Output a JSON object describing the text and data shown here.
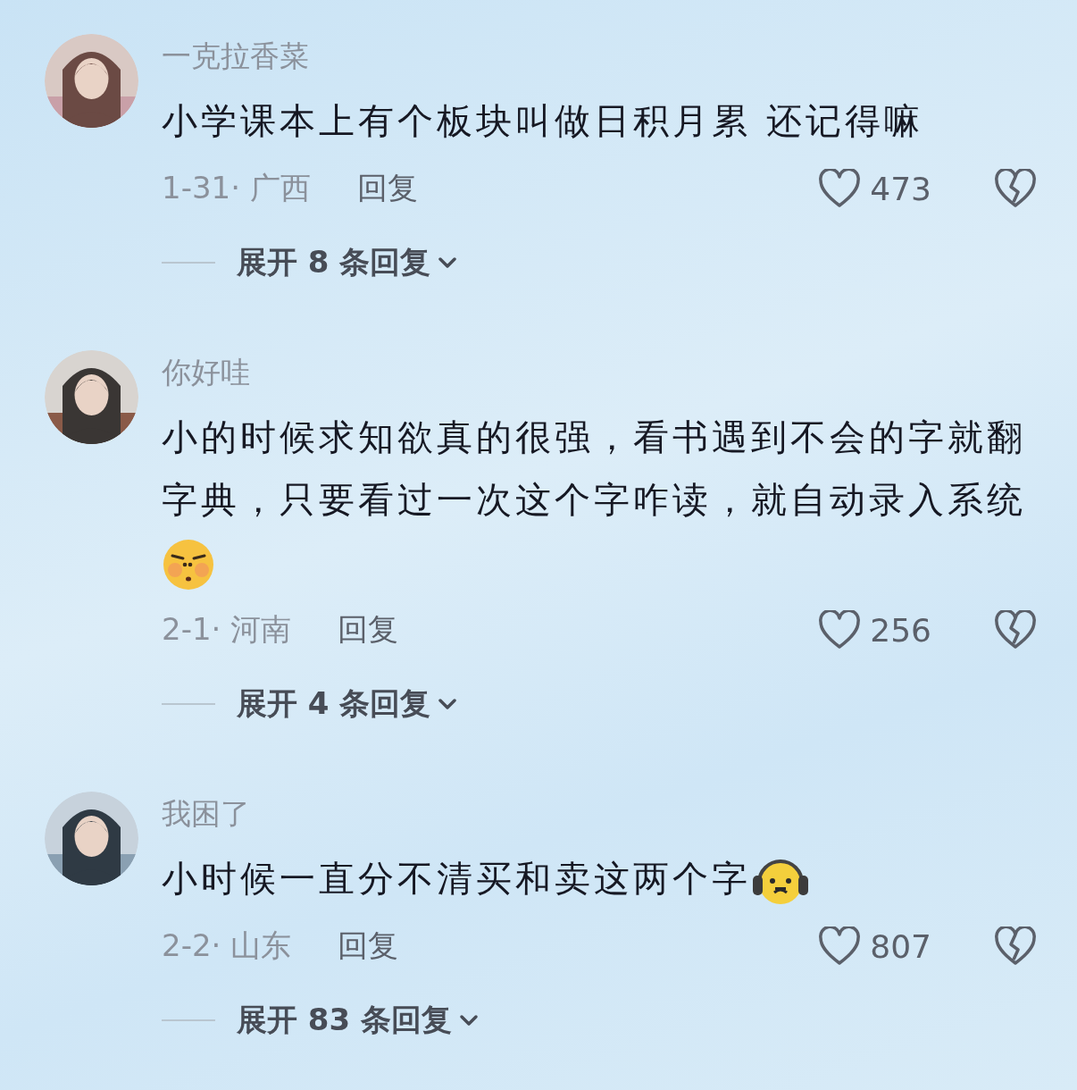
{
  "comments": [
    {
      "kind": "plain",
      "username": "一克拉香菜",
      "text": "小学课本上有个板块叫做日积月累 还记得嘛",
      "date_location": "1-31· 广西",
      "reply": "回复",
      "likes": "473",
      "expand": "展开 8 条回复"
    },
    {
      "kind": "blush",
      "username": "你好哇",
      "text": "小的时候求知欲真的很强，看书遇到不会的字就翻字典，只要看过一次这个字咋读，就自动录入系统",
      "date_location": "2-1· 河南",
      "reply": "回复",
      "likes": "256",
      "expand": "展开 4 条回复"
    },
    {
      "kind": "headphones",
      "username": "我困了",
      "text": "小时候一直分不清买和卖这两个字",
      "date_location": "2-2· 山东",
      "reply": "回复",
      "likes": "807",
      "expand": "展开 83 条回复"
    }
  ]
}
